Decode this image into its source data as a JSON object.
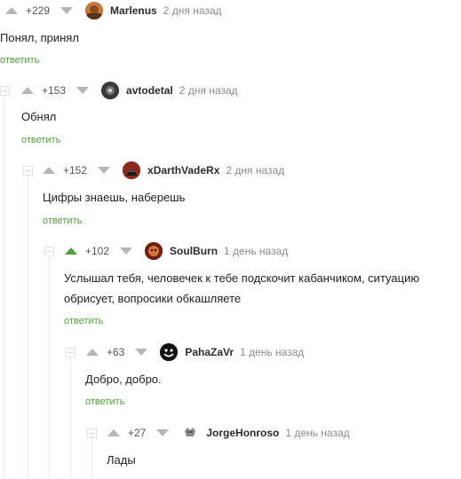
{
  "comments": [
    {
      "rating": "+229",
      "username": "Marlenus",
      "date": "2 дня назад",
      "text": "Понял, принял",
      "reply": "ответить",
      "avatar_icon": "avatar-marlenus-icon"
    },
    {
      "rating": "+153",
      "username": "avtodetal",
      "date": "2 дня назад",
      "text": "Обнял",
      "reply": "ответить",
      "avatar_icon": "avatar-avtodetal-icon"
    },
    {
      "rating": "+152",
      "username": "xDarthVadeRx",
      "date": "2 дня назад",
      "text": "Цифры знаешь, наберешь",
      "reply": "ответить",
      "avatar_icon": "avatar-darthvader-icon"
    },
    {
      "rating": "+102",
      "username": "SoulBurn",
      "date": "1 день назад",
      "text": "Услышал тебя, человечек к тебе подскочит кабанчиком, ситуацию обрисует, вопросики обкашляете",
      "reply": "ответить",
      "avatar_icon": "avatar-soulburn-icon"
    },
    {
      "rating": "+63",
      "username": "PahaZaVr",
      "date": "1 день назад",
      "text": "Добро, добро.",
      "reply": "ответить",
      "avatar_icon": "avatar-pahazavr-icon"
    },
    {
      "rating": "+27",
      "username": "JorgeHonroso",
      "date": "1 день назад",
      "text": "Лады",
      "reply": "",
      "avatar_icon": "avatar-jorgehonroso-icon"
    }
  ],
  "colors": {
    "accent": "#53a041",
    "muted": "#8c8c8c",
    "vote_inactive": "#b6b6b6"
  }
}
